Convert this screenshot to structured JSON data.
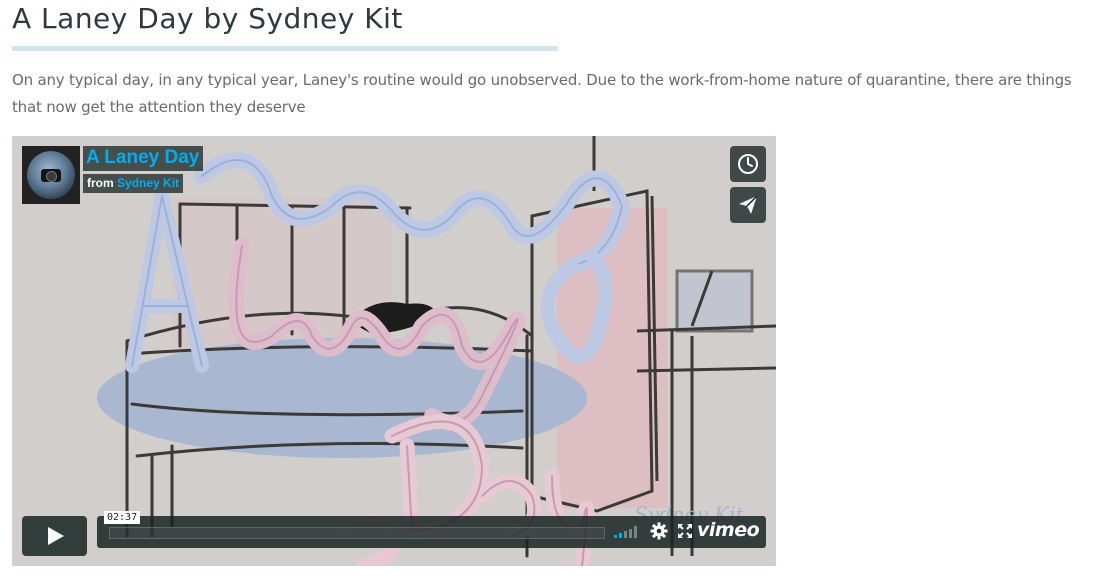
{
  "page": {
    "title": "A Laney Day by Sydney Kit",
    "description": "On any typical day, in any typical year, Laney's routine would go unobserved. Due to the work-from-home nature of quarantine, there are things that now get the attention they deserve"
  },
  "player": {
    "video_title": "A Laney Day",
    "from_label": "from",
    "author": "Sydney Kit",
    "time": "02:37",
    "brand": "vimeo",
    "progress": 0,
    "icons": {
      "watch_later": "clock-icon",
      "share": "paper-plane-icon",
      "play": "play-icon",
      "volume": "volume-bars-icon",
      "settings": "gear-icon",
      "fullscreen": "fullscreen-icon"
    },
    "artwork_text": {
      "a": "A",
      "laney": "Laney",
      "day": "Day",
      "signature": "Sydney Kit"
    }
  },
  "colors": {
    "accent": "#00adef",
    "overlay": "#172322",
    "rule": "#d3e4ea"
  }
}
